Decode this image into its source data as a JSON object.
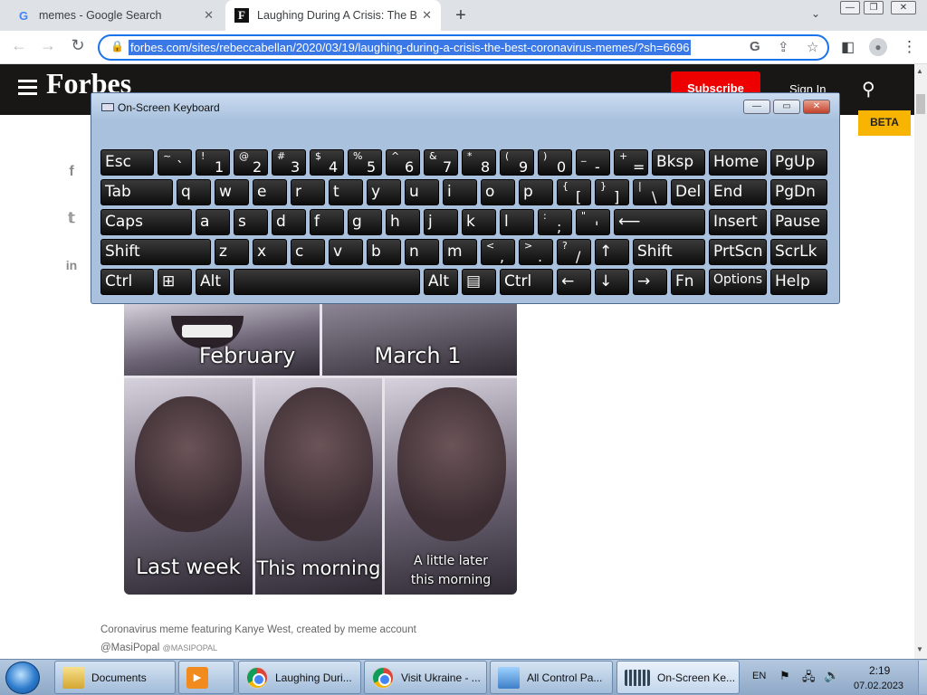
{
  "browser": {
    "tabs": [
      {
        "title": "memes - Google Search",
        "favicon": "G",
        "active": false
      },
      {
        "title": "Laughing During A Crisis: The Be",
        "favicon": "F",
        "active": true
      }
    ],
    "new_tab": "+",
    "tab_search": "⌄",
    "window_buttons": {
      "minimize": "—",
      "restore": "❐",
      "close": "✕"
    },
    "nav": {
      "back": "←",
      "forward": "→",
      "reload": "↻"
    },
    "url": "forbes.com/sites/rebeccabellan/2020/03/19/laughing-during-a-crisis-the-best-coronavirus-memes/?sh=6696",
    "omnibox_icons": {
      "google": "G",
      "share": "⇪",
      "star": "☆"
    },
    "toolbar_icons": {
      "sidebar": "◧",
      "profile": "●",
      "menu": "⋮"
    }
  },
  "forbes": {
    "logo": "Forbes",
    "subscribe": "Subscribe",
    "sign_in": "Sign In",
    "search_icon": "⚲",
    "beta": "BETA",
    "social": [
      "f",
      "𝕥",
      "in"
    ]
  },
  "meme": {
    "captions": [
      "February",
      "March 1",
      "Last week",
      "This morning",
      "A little later this morning"
    ],
    "caption_text": "Coronavirus meme featuring Kanye West, created by meme account",
    "credit_handle": "@MasiPopal",
    "credit_source": "@MASIPOPAL"
  },
  "osk": {
    "title": "On-Screen Keyboard",
    "buttons": {
      "minimize": "—",
      "restore": "▭",
      "close": "✕"
    },
    "rows": [
      [
        {
          "l": "Esc"
        },
        {
          "s": "~",
          "m": "`"
        },
        {
          "s": "!",
          "m": "1"
        },
        {
          "s": "@",
          "m": "2"
        },
        {
          "s": "#",
          "m": "3"
        },
        {
          "s": "$",
          "m": "4"
        },
        {
          "s": "%",
          "m": "5"
        },
        {
          "s": "^",
          "m": "6"
        },
        {
          "s": "&",
          "m": "7"
        },
        {
          "s": "*",
          "m": "8"
        },
        {
          "s": "(",
          "m": "9"
        },
        {
          "s": ")",
          "m": "0"
        },
        {
          "s": "_",
          "m": "-"
        },
        {
          "s": "+",
          "m": "="
        },
        {
          "l": "Bksp"
        },
        {
          "l": "Home"
        },
        {
          "l": "PgUp"
        }
      ],
      [
        {
          "l": "Tab"
        },
        {
          "l": "q"
        },
        {
          "l": "w"
        },
        {
          "l": "e"
        },
        {
          "l": "r"
        },
        {
          "l": "t"
        },
        {
          "l": "y"
        },
        {
          "l": "u"
        },
        {
          "l": "i"
        },
        {
          "l": "o"
        },
        {
          "l": "p"
        },
        {
          "s": "{",
          "m": "["
        },
        {
          "s": "}",
          "m": "]"
        },
        {
          "s": "|",
          "m": "\\"
        },
        {
          "l": "Del"
        },
        {
          "l": "End"
        },
        {
          "l": "PgDn"
        }
      ],
      [
        {
          "l": "Caps"
        },
        {
          "l": "a"
        },
        {
          "l": "s"
        },
        {
          "l": "d"
        },
        {
          "l": "f"
        },
        {
          "l": "g"
        },
        {
          "l": "h"
        },
        {
          "l": "j"
        },
        {
          "l": "k"
        },
        {
          "l": "l"
        },
        {
          "s": ":",
          "m": ";"
        },
        {
          "s": "\"",
          "m": "'"
        },
        {
          "l": "⟵"
        },
        {
          "l": "Insert"
        },
        {
          "l": "Pause"
        }
      ],
      [
        {
          "l": "Shift"
        },
        {
          "l": "z"
        },
        {
          "l": "x"
        },
        {
          "l": "c"
        },
        {
          "l": "v"
        },
        {
          "l": "b"
        },
        {
          "l": "n"
        },
        {
          "l": "m"
        },
        {
          "s": "<",
          "m": ","
        },
        {
          "s": ">",
          "m": "."
        },
        {
          "s": "?",
          "m": "/"
        },
        {
          "l": "↑"
        },
        {
          "l": "Shift"
        },
        {
          "l": "PrtScn"
        },
        {
          "l": "ScrLk"
        }
      ],
      [
        {
          "l": "Ctrl"
        },
        {
          "l": "⊞"
        },
        {
          "l": "Alt"
        },
        {
          "l": ""
        },
        {
          "l": "Alt"
        },
        {
          "l": "▤"
        },
        {
          "l": "Ctrl"
        },
        {
          "l": "←"
        },
        {
          "l": "↓"
        },
        {
          "l": "→"
        },
        {
          "l": "Fn"
        },
        {
          "l": "Options"
        },
        {
          "l": "Help"
        }
      ]
    ]
  },
  "taskbar": {
    "items": [
      {
        "label": "Documents"
      },
      {
        "label": ""
      },
      {
        "label": "Laughing Duri..."
      },
      {
        "label": "Visit Ukraine - ..."
      },
      {
        "label": "All Control Pa..."
      },
      {
        "label": "On-Screen Ke..."
      }
    ],
    "lang": "EN",
    "time": "2:19",
    "date": "07.02.2023"
  }
}
